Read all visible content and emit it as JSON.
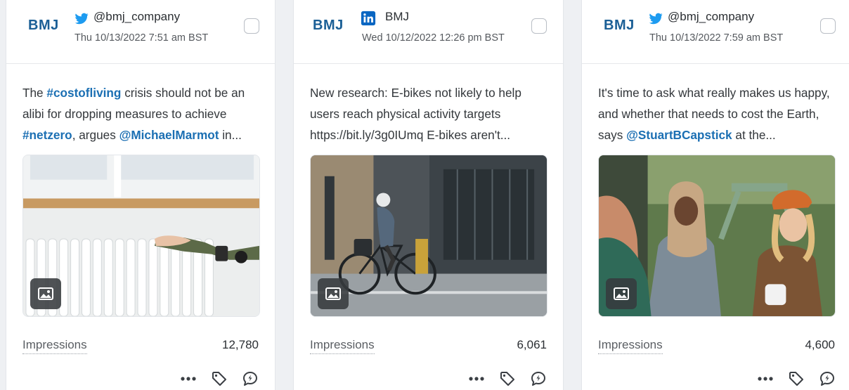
{
  "posts": [
    {
      "logo": "BMJ",
      "network": "twitter-icon",
      "handle": "@bmj_company",
      "date": "Thu 10/13/2022 7:51 am BST",
      "text_parts": [
        "The ",
        "#costofliving",
        " crisis should not be an alibi for dropping measures to achieve ",
        "#netzero",
        ", argues ",
        "@MichaelMarmot",
        " in..."
      ],
      "metric_label": "Impressions",
      "metric_value": "12,780"
    },
    {
      "logo": "BMJ",
      "network": "linkedin-icon",
      "handle": "BMJ",
      "date": "Wed 10/12/2022 12:26 pm BST",
      "text_parts": [
        "New research: E-bikes not likely to help users reach physical activity targets https://bit.ly/3g0IUmq E-bikes aren't..."
      ],
      "metric_label": "Impressions",
      "metric_value": "6,061"
    },
    {
      "logo": "BMJ",
      "network": "twitter-icon",
      "handle": "@bmj_company",
      "date": "Thu 10/13/2022 7:59 am BST",
      "text_parts": [
        "It's time to ask what really makes us happy, and whether that needs to cost the Earth, says ",
        "@StuartBCapstick",
        " at the..."
      ],
      "metric_label": "Impressions",
      "metric_value": "4,600"
    }
  ],
  "colors": {
    "brand": "#1b5f96",
    "link": "#1b6fb3",
    "twitter": "#1d9bf0",
    "linkedin": "#0a66c2"
  },
  "icons": {
    "more": "more-icon",
    "tag": "tag-icon",
    "reply": "reply-icon",
    "media": "image-icon"
  }
}
